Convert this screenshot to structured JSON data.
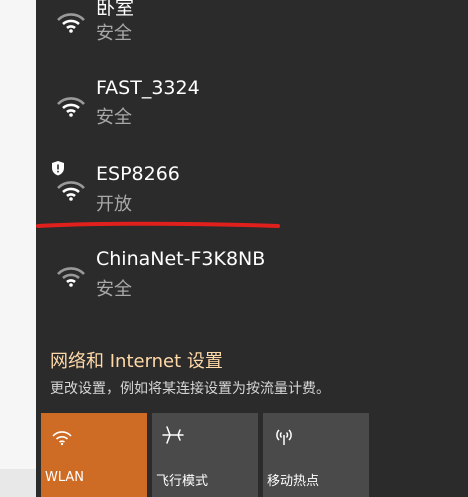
{
  "networks": [
    {
      "ssid": "卧室",
      "status": "安全"
    },
    {
      "ssid": "FAST_3324",
      "status": "安全"
    },
    {
      "ssid": "ESP8266",
      "status": "开放"
    },
    {
      "ssid": "ChinaNet-F3K8NB",
      "status": "安全"
    }
  ],
  "settings": {
    "link": "网络和 Internet 设置",
    "description": "更改设置，例如将某连接设置为按流量计费。"
  },
  "quick_actions": [
    {
      "label": "WLAN",
      "icon": "wifi-icon",
      "active": true
    },
    {
      "label": "飞行模式",
      "icon": "airplane-icon",
      "active": false
    },
    {
      "label": "移动热点",
      "icon": "hotspot-icon",
      "active": false
    }
  ],
  "colors": {
    "panel_bg": "#2b2b2b",
    "accent": "#ce6b24",
    "tile_bg": "#4a4a4a",
    "link": "#ffd9a8",
    "annotation_red": "#e0201c"
  }
}
